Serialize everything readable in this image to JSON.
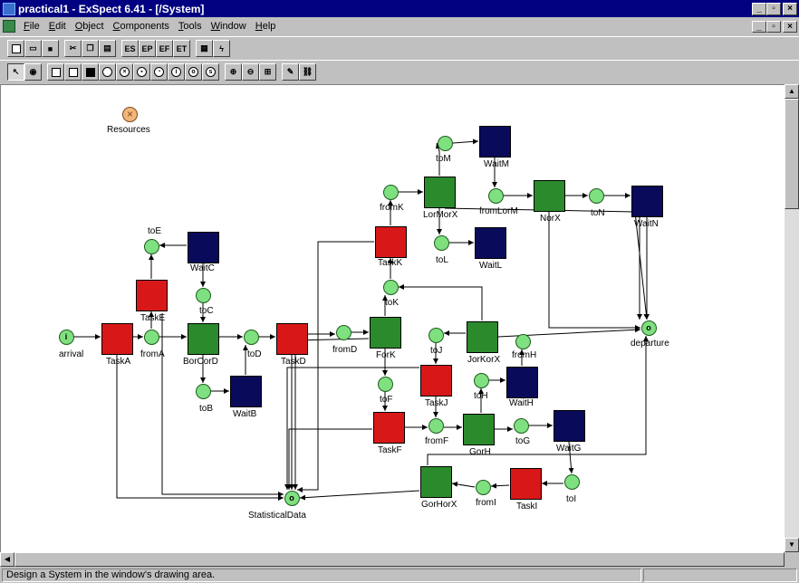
{
  "window": {
    "title": "practical1 - ExSpect 6.41 - [/System]",
    "title_buttons": [
      "_",
      "▫",
      "×"
    ],
    "doc_buttons": [
      "_",
      "▫",
      "×"
    ]
  },
  "menu": [
    "File",
    "Edit",
    "Object",
    "Components",
    "Tools",
    "Window",
    "Help"
  ],
  "toolbar1": [
    "new",
    "open",
    "save",
    "cut",
    "copy",
    "paste",
    "ES",
    "EP",
    "EF",
    "ET",
    "check",
    "run"
  ],
  "toolbar1_text": {
    "ES": "ES",
    "EP": "EP",
    "EF": "EF",
    "ET": "ET"
  },
  "toolbar2": [
    "select",
    "hand",
    "rect-empty",
    "rect-half",
    "rect-filled",
    "circle",
    "circle-x",
    "circle-store",
    "circle-clock",
    "circle-i",
    "circle-o",
    "circle-s",
    "zoom-in",
    "zoom-out",
    "zoom-fit",
    "edit",
    "link"
  ],
  "status": {
    "text": "Design a System in the window's drawing area."
  },
  "net": {
    "colors": {
      "red": "#d81818",
      "green": "#2b8a2b",
      "blue": "#0a0a5a",
      "place": "#7fe07f"
    },
    "resources_label": "Resources",
    "places": {
      "arrival": {
        "label": "arrival",
        "mark": "i"
      },
      "fromA": {
        "label": "fromA"
      },
      "toE": {
        "label": "toE"
      },
      "toC": {
        "label": "toC"
      },
      "toD": {
        "label": "toD"
      },
      "toB": {
        "label": "toB"
      },
      "fromD": {
        "label": "fromD"
      },
      "toK": {
        "label": "toK"
      },
      "fromK": {
        "label": "fromK"
      },
      "toM": {
        "label": "toM"
      },
      "fromLorM": {
        "label": "fromLorM"
      },
      "toL": {
        "label": "toL"
      },
      "toN": {
        "label": "toN"
      },
      "departure": {
        "label": "departure",
        "mark": "o"
      },
      "toJ": {
        "label": "toJ"
      },
      "fromH": {
        "label": "fromH"
      },
      "toF": {
        "label": "toF"
      },
      "toH": {
        "label": "toH"
      },
      "fromF": {
        "label": "fromF"
      },
      "toG": {
        "label": "toG"
      },
      "toI": {
        "label": "toI"
      },
      "fromI": {
        "label": "fromI"
      },
      "statistical": {
        "label": "StatisticalData",
        "mark": "o"
      }
    },
    "transitions": {
      "TaskA": {
        "label": "TaskA"
      },
      "TaskE": {
        "label": "TaskE"
      },
      "WaitC": {
        "label": "WaitC"
      },
      "BorCorD": {
        "label": "BorCorD"
      },
      "WaitB": {
        "label": "WaitB"
      },
      "TaskD": {
        "label": "TaskD"
      },
      "ForK": {
        "label": "ForK"
      },
      "TaskK": {
        "label": "TaskK"
      },
      "LorMorX": {
        "label": "LorMorX"
      },
      "WaitM": {
        "label": "WaitM"
      },
      "WaitL": {
        "label": "WaitL"
      },
      "NorX": {
        "label": "NorX"
      },
      "WaitN": {
        "label": "WaitN"
      },
      "JorKorX": {
        "label": "JorKorX"
      },
      "TaskJ": {
        "label": "TaskJ"
      },
      "WaitH": {
        "label": "WaitH"
      },
      "TaskF": {
        "label": "TaskF"
      },
      "GorH": {
        "label": "GorH"
      },
      "WaitG": {
        "label": "WaitG"
      },
      "GorHorX": {
        "label": "GorHorX"
      },
      "TaskI": {
        "label": "TaskI"
      }
    }
  }
}
